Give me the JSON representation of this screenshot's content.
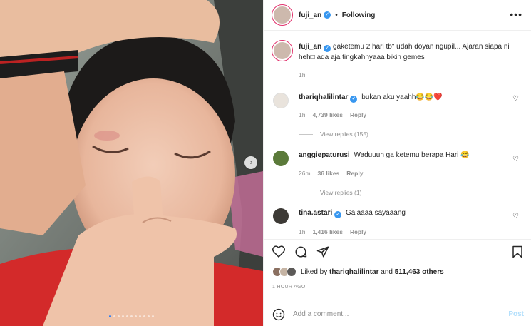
{
  "header": {
    "username": "fuji_an",
    "separator": "•",
    "follow_status": "Following",
    "more_label": "•••"
  },
  "caption": {
    "username": "fuji_an",
    "text": "gaketemu 2 hari tb\" udah doyan ngupil... Ajaran siapa ni heh\u0000 ada aja tingkahnyaaa bikin gemes",
    "time": "1h"
  },
  "comments": [
    {
      "username": "thariqhalilintar",
      "verified": true,
      "text": "bukan aku yaahh😂😂❤️",
      "time": "1h",
      "likes": "4,739 likes",
      "reply": "Reply",
      "view_replies": "View replies (155)"
    },
    {
      "username": "anggiepaturusi",
      "verified": false,
      "text": "Waduuuh ga ketemu berapa Hari 😂",
      "time": "26m",
      "likes": "36 likes",
      "reply": "Reply",
      "view_replies": "View replies (1)"
    },
    {
      "username": "tina.astari",
      "verified": true,
      "text": "Galaaaa sayaaang",
      "time": "1h",
      "likes": "1,416 likes",
      "reply": "Reply"
    }
  ],
  "actions": {
    "liked_prefix": "Liked by",
    "liked_user": "thariqhalilintar",
    "liked_and": "and",
    "liked_others": "511,463 others",
    "post_time": "1 HOUR AGO"
  },
  "add_comment": {
    "placeholder": "Add a comment...",
    "post_label": "Post"
  },
  "carousel": {
    "dot_count": 11,
    "active_index": 0,
    "next_icon": "›"
  },
  "colors": {
    "verified": "#3897f0",
    "active_dot": "#2d7ef7",
    "post_disabled": "#b2dffc",
    "story_ring": "#e1306c"
  }
}
